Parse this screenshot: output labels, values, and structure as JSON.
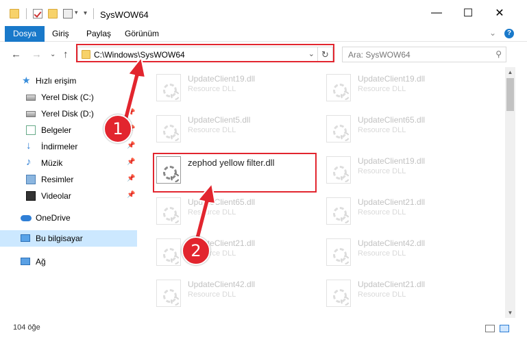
{
  "window": {
    "title": "SysWOW64",
    "minimize": "—",
    "maximize": "☐",
    "close": "✕"
  },
  "ribbon": {
    "tabs": [
      "Dosya",
      "Giriş",
      "Paylaş",
      "Görünüm"
    ],
    "expand": "⌄",
    "help": "?"
  },
  "nav": {
    "back": "←",
    "forward": "→",
    "recent": "⌄",
    "up": "↑",
    "address": "C:\\Windows\\SysWOW64",
    "address_dropdown": "⌄",
    "refresh": "↻",
    "search_placeholder": "Ara: SysWOW64"
  },
  "sidebar": {
    "items": [
      {
        "label": "Hızlı erişim",
        "icon": "star-icon"
      },
      {
        "label": "Yerel Disk (C:)",
        "icon": "drive-icon"
      },
      {
        "label": "Yerel Disk (D:)",
        "icon": "drive-icon"
      },
      {
        "label": "Belgeler",
        "icon": "documents-icon"
      },
      {
        "label": "İndirmeler",
        "icon": "downloads-icon"
      },
      {
        "label": "Müzik",
        "icon": "music-icon"
      },
      {
        "label": "Resimler",
        "icon": "pictures-icon"
      },
      {
        "label": "Videolar",
        "icon": "videos-icon"
      },
      {
        "label": "OneDrive",
        "icon": "onedrive-icon"
      },
      {
        "label": "Bu bilgisayar",
        "icon": "this-pc-icon"
      },
      {
        "label": "Ağ",
        "icon": "network-icon"
      }
    ],
    "pin": "📌"
  },
  "files": {
    "left": [
      {
        "name": "UpdateClient19.dll",
        "type": "Resource DLL"
      },
      {
        "name": "UpdateClient5.dll",
        "type": "Resource DLL"
      },
      {
        "name": "zephod yellow filter.dll",
        "type": ""
      },
      {
        "name": "UpdateClient65.dll",
        "type": "Resource DLL"
      },
      {
        "name": "UpdateClient21.dll",
        "type": "Resource DLL"
      },
      {
        "name": "UpdateClient42.dll",
        "type": "Resource DLL"
      }
    ],
    "right": [
      {
        "name": "UpdateClient19.dll",
        "type": "Resource DLL"
      },
      {
        "name": "UpdateClient65.dll",
        "type": "Resource DLL"
      },
      {
        "name": "UpdateClient19.dll",
        "type": "Resource DLL"
      },
      {
        "name": "UpdateClient21.dll",
        "type": "Resource DLL"
      },
      {
        "name": "UpdateClient42.dll",
        "type": "Resource DLL"
      },
      {
        "name": "UpdateClient21.dll",
        "type": "Resource DLL"
      }
    ]
  },
  "status": {
    "item_count": "104 öğe"
  },
  "annotations": {
    "step1": "1",
    "step2": "2",
    "highlight_color": "#e2252e"
  },
  "scrollbar": {
    "up": "▲",
    "down": "▼"
  }
}
